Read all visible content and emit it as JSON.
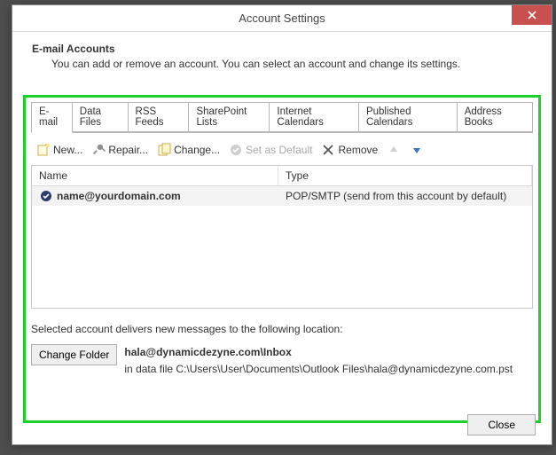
{
  "window": {
    "title": "Account Settings"
  },
  "header": {
    "title": "E-mail Accounts",
    "desc": "You can add or remove an account. You can select an account and change its settings."
  },
  "tabs": [
    {
      "label": "E-mail",
      "active": true
    },
    {
      "label": "Data Files"
    },
    {
      "label": "RSS Feeds"
    },
    {
      "label": "SharePoint Lists"
    },
    {
      "label": "Internet Calendars"
    },
    {
      "label": "Published Calendars"
    },
    {
      "label": "Address Books"
    }
  ],
  "toolbar": {
    "new_label": "New...",
    "repair_label": "Repair...",
    "change_label": "Change...",
    "setdefault_label": "Set as Default",
    "remove_label": "Remove"
  },
  "table": {
    "columns": {
      "name": "Name",
      "type": "Type"
    },
    "rows": [
      {
        "name": "name@yourdomain.com",
        "type": "POP/SMTP (send from this account by default)"
      }
    ]
  },
  "deliver": {
    "note": "Selected account delivers new messages to the following location:",
    "change_folder_label": "Change Folder",
    "folder_path": "hala@dynamicdezyne.com\\Inbox",
    "data_file": "in data file C:\\Users\\User\\Documents\\Outlook Files\\hala@dynamicdezyne.com.pst"
  },
  "footer": {
    "close_label": "Close"
  }
}
